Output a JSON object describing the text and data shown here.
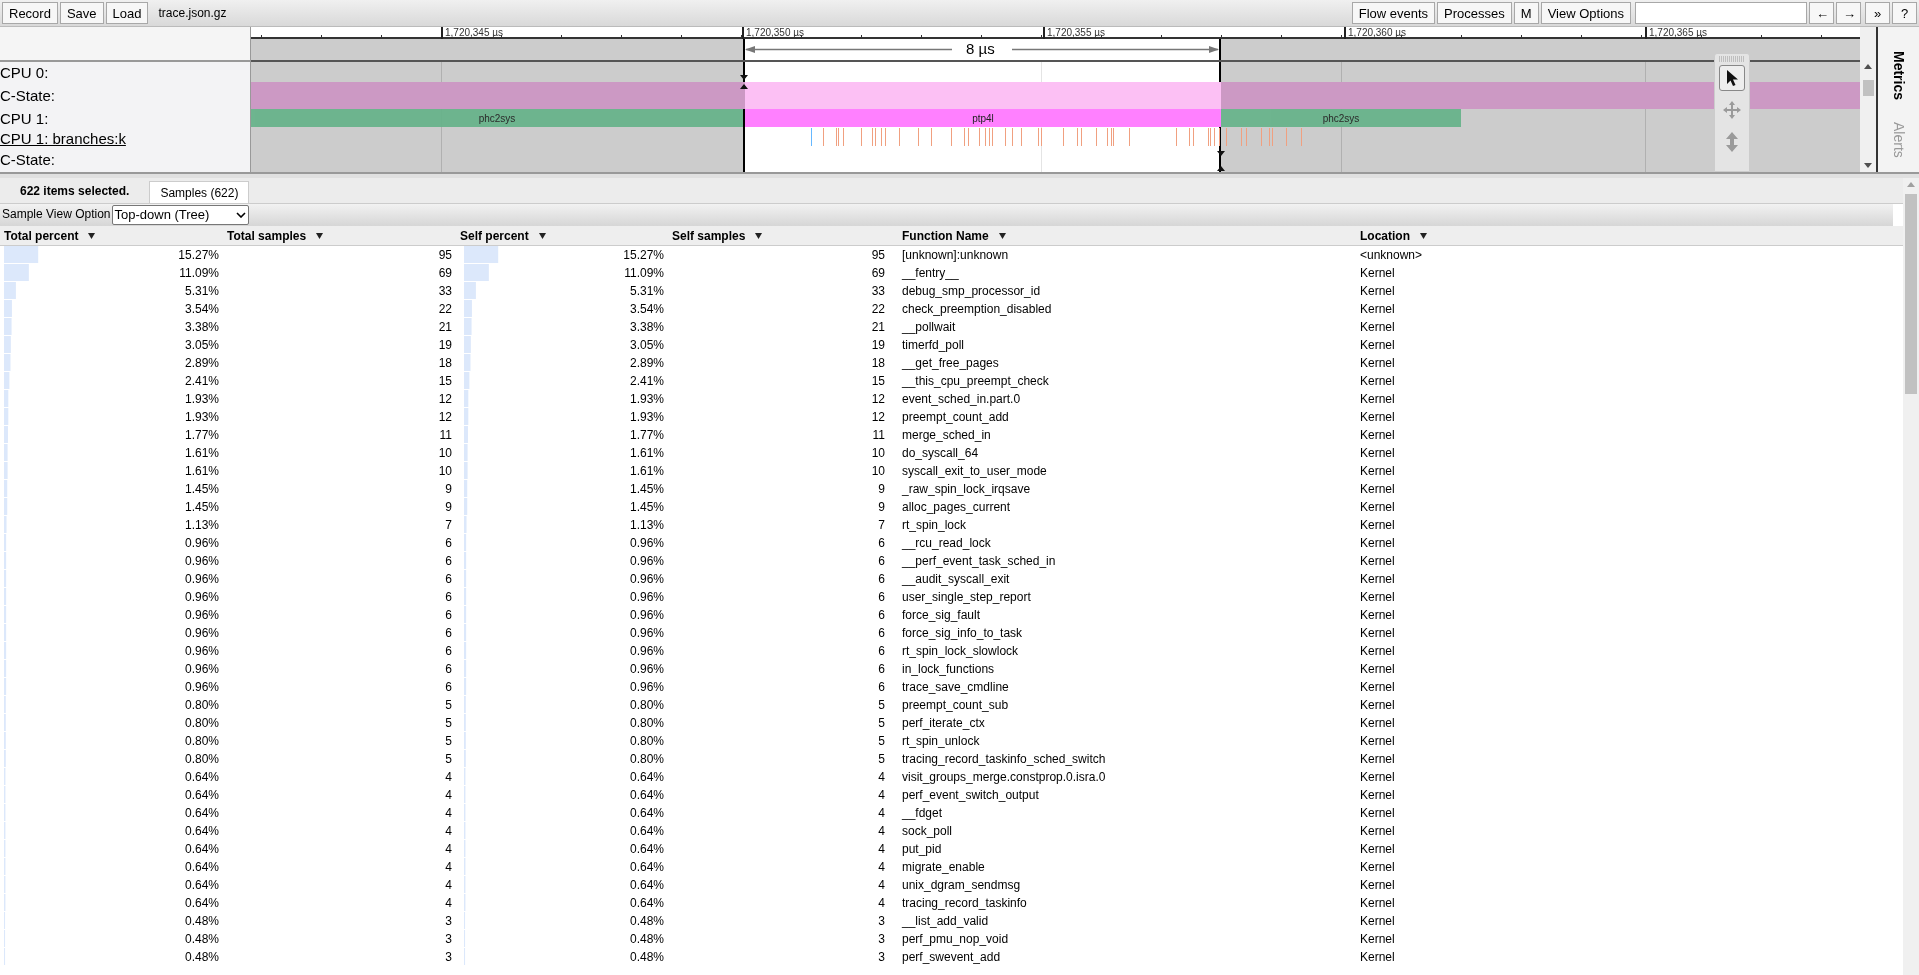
{
  "toolbar": {
    "left_buttons": [
      "Record",
      "Save",
      "Load"
    ],
    "filename": "trace.json.gz",
    "right_buttons": [
      "Flow events",
      "Processes",
      "M",
      "View Options"
    ],
    "nav_buttons": [
      "←",
      "→",
      "»",
      "?"
    ]
  },
  "timeline": {
    "ticks": [
      "1,720,345 µs",
      "1,720,350 µs",
      "1,720,355 µs",
      "1,720,360 µs",
      "1,720,365 µs"
    ],
    "selection_label": "8 µs",
    "tracks": [
      {
        "label": "CPU 0:",
        "kind": "cpu",
        "link": false
      },
      {
        "label": "C-State:",
        "kind": "cstate",
        "link": false
      },
      {
        "label": "CPU 1:",
        "kind": "slices",
        "link": false,
        "slices": [
          {
            "name": "phc2sys",
            "color": "#68b38b",
            "selected": false
          },
          {
            "name": "ptp4l",
            "color": "#ff80ff",
            "selected": true
          },
          {
            "name": "phc2sys",
            "color": "#68b38b",
            "selected": false
          }
        ]
      },
      {
        "label": "CPU 1: branches:k",
        "kind": "samples",
        "link": true
      },
      {
        "label": "C-State:",
        "kind": "empty",
        "link": false
      }
    ]
  },
  "side_tabs": [
    {
      "label": "Metrics",
      "selected": true
    },
    {
      "label": "Alerts",
      "selected": false
    }
  ],
  "analysis": {
    "summary": "622 items selected.",
    "tabs": [
      {
        "label": "Samples (622)",
        "selected": true
      }
    ],
    "view_option": {
      "label": "Sample View Option",
      "value": "Top-down (Tree)"
    },
    "columns": [
      "Total percent",
      "Total samples",
      "Self percent",
      "Self samples",
      "Function Name",
      "Location"
    ],
    "rows": [
      {
        "total": {
          "percent": "15.27%",
          "level": 0.1527
        },
        "total_samples": "95",
        "self": {
          "percent": "15.27%",
          "level": 0.1527
        },
        "self_samples": "95",
        "function": "[unknown]:unknown",
        "location": "<unknown>"
      },
      {
        "total": {
          "percent": "11.09%",
          "level": 0.1109
        },
        "total_samples": "69",
        "self": {
          "percent": "11.09%",
          "level": 0.1109
        },
        "self_samples": "69",
        "function": "__fentry__",
        "location": "Kernel"
      },
      {
        "total": {
          "percent": "5.31%",
          "level": 0.0531
        },
        "total_samples": "33",
        "self": {
          "percent": "5.31%",
          "level": 0.0531
        },
        "self_samples": "33",
        "function": "debug_smp_processor_id",
        "location": "Kernel"
      },
      {
        "total": {
          "percent": "3.54%",
          "level": 0.0354
        },
        "total_samples": "22",
        "self": {
          "percent": "3.54%",
          "level": 0.0354
        },
        "self_samples": "22",
        "function": "check_preemption_disabled",
        "location": "Kernel"
      },
      {
        "total": {
          "percent": "3.38%",
          "level": 0.0338
        },
        "total_samples": "21",
        "self": {
          "percent": "3.38%",
          "level": 0.0338
        },
        "self_samples": "21",
        "function": "__pollwait",
        "location": "Kernel"
      },
      {
        "total": {
          "percent": "3.05%",
          "level": 0.0305
        },
        "total_samples": "19",
        "self": {
          "percent": "3.05%",
          "level": 0.0305
        },
        "self_samples": "19",
        "function": "timerfd_poll",
        "location": "Kernel"
      },
      {
        "total": {
          "percent": "2.89%",
          "level": 0.0289
        },
        "total_samples": "18",
        "self": {
          "percent": "2.89%",
          "level": 0.0289
        },
        "self_samples": "18",
        "function": "__get_free_pages",
        "location": "Kernel"
      },
      {
        "total": {
          "percent": "2.41%",
          "level": 0.0241
        },
        "total_samples": "15",
        "self": {
          "percent": "2.41%",
          "level": 0.0241
        },
        "self_samples": "15",
        "function": "__this_cpu_preempt_check",
        "location": "Kernel"
      },
      {
        "total": {
          "percent": "1.93%",
          "level": 0.0193
        },
        "total_samples": "12",
        "self": {
          "percent": "1.93%",
          "level": 0.0193
        },
        "self_samples": "12",
        "function": "event_sched_in.part.0",
        "location": "Kernel"
      },
      {
        "total": {
          "percent": "1.93%",
          "level": 0.0193
        },
        "total_samples": "12",
        "self": {
          "percent": "1.93%",
          "level": 0.0193
        },
        "self_samples": "12",
        "function": "preempt_count_add",
        "location": "Kernel"
      },
      {
        "total": {
          "percent": "1.77%",
          "level": 0.0177
        },
        "total_samples": "11",
        "self": {
          "percent": "1.77%",
          "level": 0.0177
        },
        "self_samples": "11",
        "function": "merge_sched_in",
        "location": "Kernel"
      },
      {
        "total": {
          "percent": "1.61%",
          "level": 0.0161
        },
        "total_samples": "10",
        "self": {
          "percent": "1.61%",
          "level": 0.0161
        },
        "self_samples": "10",
        "function": "do_syscall_64",
        "location": "Kernel"
      },
      {
        "total": {
          "percent": "1.61%",
          "level": 0.0161
        },
        "total_samples": "10",
        "self": {
          "percent": "1.61%",
          "level": 0.0161
        },
        "self_samples": "10",
        "function": "syscall_exit_to_user_mode",
        "location": "Kernel"
      },
      {
        "total": {
          "percent": "1.45%",
          "level": 0.0145
        },
        "total_samples": "9",
        "self": {
          "percent": "1.45%",
          "level": 0.0145
        },
        "self_samples": "9",
        "function": "_raw_spin_lock_irqsave",
        "location": "Kernel"
      },
      {
        "total": {
          "percent": "1.45%",
          "level": 0.0145
        },
        "total_samples": "9",
        "self": {
          "percent": "1.45%",
          "level": 0.0145
        },
        "self_samples": "9",
        "function": "alloc_pages_current",
        "location": "Kernel"
      },
      {
        "total": {
          "percent": "1.13%",
          "level": 0.0113
        },
        "total_samples": "7",
        "self": {
          "percent": "1.13%",
          "level": 0.0113
        },
        "self_samples": "7",
        "function": "rt_spin_lock",
        "location": "Kernel"
      },
      {
        "total": {
          "percent": "0.96%",
          "level": 0.0096
        },
        "total_samples": "6",
        "self": {
          "percent": "0.96%",
          "level": 0.0096
        },
        "self_samples": "6",
        "function": "__rcu_read_lock",
        "location": "Kernel"
      },
      {
        "total": {
          "percent": "0.96%",
          "level": 0.0096
        },
        "total_samples": "6",
        "self": {
          "percent": "0.96%",
          "level": 0.0096
        },
        "self_samples": "6",
        "function": "__perf_event_task_sched_in",
        "location": "Kernel"
      },
      {
        "total": {
          "percent": "0.96%",
          "level": 0.0096
        },
        "total_samples": "6",
        "self": {
          "percent": "0.96%",
          "level": 0.0096
        },
        "self_samples": "6",
        "function": "__audit_syscall_exit",
        "location": "Kernel"
      },
      {
        "total": {
          "percent": "0.96%",
          "level": 0.0096
        },
        "total_samples": "6",
        "self": {
          "percent": "0.96%",
          "level": 0.0096
        },
        "self_samples": "6",
        "function": "user_single_step_report",
        "location": "Kernel"
      },
      {
        "total": {
          "percent": "0.96%",
          "level": 0.0096
        },
        "total_samples": "6",
        "self": {
          "percent": "0.96%",
          "level": 0.0096
        },
        "self_samples": "6",
        "function": "force_sig_fault",
        "location": "Kernel"
      },
      {
        "total": {
          "percent": "0.96%",
          "level": 0.0096
        },
        "total_samples": "6",
        "self": {
          "percent": "0.96%",
          "level": 0.0096
        },
        "self_samples": "6",
        "function": "force_sig_info_to_task",
        "location": "Kernel"
      },
      {
        "total": {
          "percent": "0.96%",
          "level": 0.0096
        },
        "total_samples": "6",
        "self": {
          "percent": "0.96%",
          "level": 0.0096
        },
        "self_samples": "6",
        "function": "rt_spin_lock_slowlock",
        "location": "Kernel"
      },
      {
        "total": {
          "percent": "0.96%",
          "level": 0.0096
        },
        "total_samples": "6",
        "self": {
          "percent": "0.96%",
          "level": 0.0096
        },
        "self_samples": "6",
        "function": "in_lock_functions",
        "location": "Kernel"
      },
      {
        "total": {
          "percent": "0.96%",
          "level": 0.0096
        },
        "total_samples": "6",
        "self": {
          "percent": "0.96%",
          "level": 0.0096
        },
        "self_samples": "6",
        "function": "trace_save_cmdline",
        "location": "Kernel"
      },
      {
        "total": {
          "percent": "0.80%",
          "level": 0.008
        },
        "total_samples": "5",
        "self": {
          "percent": "0.80%",
          "level": 0.008
        },
        "self_samples": "5",
        "function": "preempt_count_sub",
        "location": "Kernel"
      },
      {
        "total": {
          "percent": "0.80%",
          "level": 0.008
        },
        "total_samples": "5",
        "self": {
          "percent": "0.80%",
          "level": 0.008
        },
        "self_samples": "5",
        "function": "perf_iterate_ctx",
        "location": "Kernel"
      },
      {
        "total": {
          "percent": "0.80%",
          "level": 0.008
        },
        "total_samples": "5",
        "self": {
          "percent": "0.80%",
          "level": 0.008
        },
        "self_samples": "5",
        "function": "rt_spin_unlock",
        "location": "Kernel"
      },
      {
        "total": {
          "percent": "0.80%",
          "level": 0.008
        },
        "total_samples": "5",
        "self": {
          "percent": "0.80%",
          "level": 0.008
        },
        "self_samples": "5",
        "function": "tracing_record_taskinfo_sched_switch",
        "location": "Kernel"
      },
      {
        "total": {
          "percent": "0.64%",
          "level": 0.0064
        },
        "total_samples": "4",
        "self": {
          "percent": "0.64%",
          "level": 0.0064
        },
        "self_samples": "4",
        "function": "visit_groups_merge.constprop.0.isra.0",
        "location": "Kernel"
      },
      {
        "total": {
          "percent": "0.64%",
          "level": 0.0064
        },
        "total_samples": "4",
        "self": {
          "percent": "0.64%",
          "level": 0.0064
        },
        "self_samples": "4",
        "function": "perf_event_switch_output",
        "location": "Kernel"
      },
      {
        "total": {
          "percent": "0.64%",
          "level": 0.0064
        },
        "total_samples": "4",
        "self": {
          "percent": "0.64%",
          "level": 0.0064
        },
        "self_samples": "4",
        "function": "__fdget",
        "location": "Kernel"
      },
      {
        "total": {
          "percent": "0.64%",
          "level": 0.0064
        },
        "total_samples": "4",
        "self": {
          "percent": "0.64%",
          "level": 0.0064
        },
        "self_samples": "4",
        "function": "sock_poll",
        "location": "Kernel"
      },
      {
        "total": {
          "percent": "0.64%",
          "level": 0.0064
        },
        "total_samples": "4",
        "self": {
          "percent": "0.64%",
          "level": 0.0064
        },
        "self_samples": "4",
        "function": "put_pid",
        "location": "Kernel"
      },
      {
        "total": {
          "percent": "0.64%",
          "level": 0.0064
        },
        "total_samples": "4",
        "self": {
          "percent": "0.64%",
          "level": 0.0064
        },
        "self_samples": "4",
        "function": "migrate_enable",
        "location": "Kernel"
      },
      {
        "total": {
          "percent": "0.64%",
          "level": 0.0064
        },
        "total_samples": "4",
        "self": {
          "percent": "0.64%",
          "level": 0.0064
        },
        "self_samples": "4",
        "function": "unix_dgram_sendmsg",
        "location": "Kernel"
      },
      {
        "total": {
          "percent": "0.64%",
          "level": 0.0064
        },
        "total_samples": "4",
        "self": {
          "percent": "0.64%",
          "level": 0.0064
        },
        "self_samples": "4",
        "function": "tracing_record_taskinfo",
        "location": "Kernel"
      },
      {
        "total": {
          "percent": "0.48%",
          "level": 0.0048
        },
        "total_samples": "3",
        "self": {
          "percent": "0.48%",
          "level": 0.0048
        },
        "self_samples": "3",
        "function": "__list_add_valid",
        "location": "Kernel"
      },
      {
        "total": {
          "percent": "0.48%",
          "level": 0.0048
        },
        "total_samples": "3",
        "self": {
          "percent": "0.48%",
          "level": 0.0048
        },
        "self_samples": "3",
        "function": "perf_pmu_nop_void",
        "location": "Kernel"
      },
      {
        "total": {
          "percent": "0.48%",
          "level": 0.0048
        },
        "total_samples": "3",
        "self": {
          "percent": "0.48%",
          "level": 0.0048
        },
        "self_samples": "3",
        "function": "perf_swevent_add",
        "location": "Kernel"
      }
    ]
  }
}
